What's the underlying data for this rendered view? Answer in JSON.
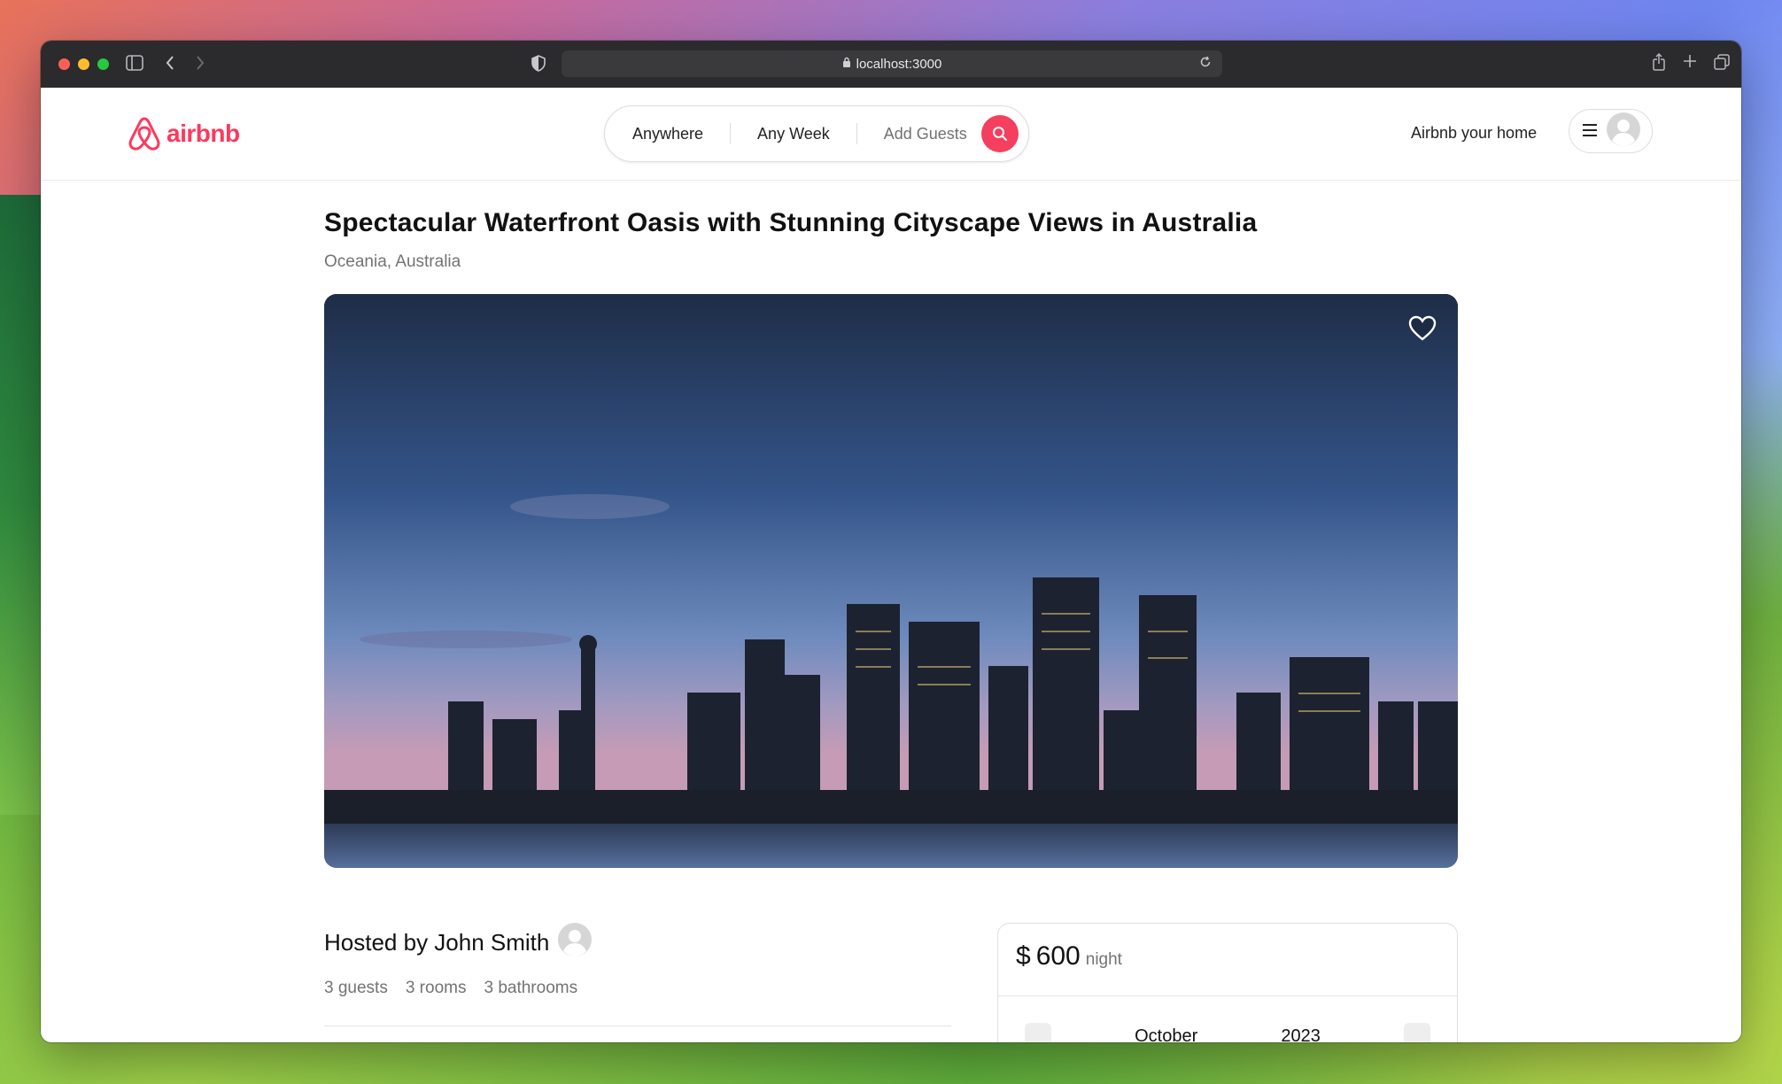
{
  "browser": {
    "url": "localhost:3000"
  },
  "navbar": {
    "logo_text": "airbnb",
    "search": {
      "location": "Anywhere",
      "dates": "Any Week",
      "guests": "Add Guests"
    },
    "host_link": "Airbnb your home"
  },
  "listing": {
    "title": "Spectacular Waterfront Oasis with Stunning Cityscape Views in Australia",
    "location": "Oceania, Australia",
    "host": "Hosted by John Smith",
    "stats": [
      "3 guests",
      "3 rooms",
      "3 bathrooms"
    ]
  },
  "reservation": {
    "currency": "$",
    "price": "600",
    "unit": "night",
    "calendar_month": "October",
    "calendar_year": "2023"
  },
  "colors": {
    "brand": "#ff385c",
    "search_button": "#f43f5e"
  }
}
